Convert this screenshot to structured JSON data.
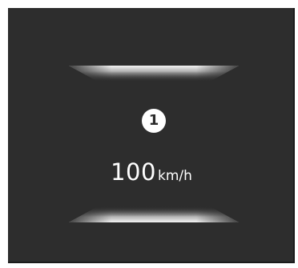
{
  "display": {
    "background_color": "#2d2d2d",
    "glow_color": "#ffffff",
    "marker_number": "1",
    "speed_value": "100",
    "speed_unit": "km/h"
  }
}
